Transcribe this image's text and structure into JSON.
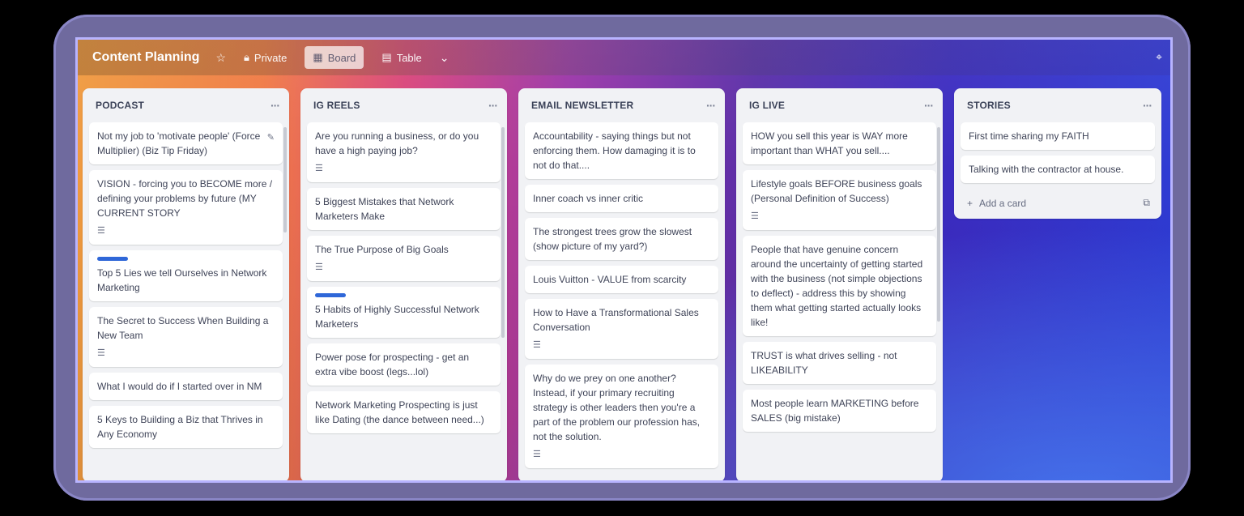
{
  "board": {
    "title": "Content Planning",
    "star_icon": "star-icon",
    "visibility": "Private",
    "views": [
      {
        "label": "Board",
        "icon": "board-icon",
        "active": true
      },
      {
        "label": "Table",
        "icon": "table-icon",
        "active": false
      }
    ],
    "more_views_icon": "chevron-down-icon",
    "right_icon": "pin-icon"
  },
  "lists": [
    {
      "title": "PODCAST",
      "cards": [
        {
          "text": "Not my job to 'motivate people' (Force Multiplier) (Biz Tip Friday)",
          "edit": true
        },
        {
          "text": "VISION - forcing you to BECOME more / defining your problems by future (MY CURRENT STORY",
          "desc": true
        },
        {
          "text": "Top 5 Lies we tell Ourselves in Network Marketing",
          "label": true
        },
        {
          "text": "The Secret to Success When Building a New Team",
          "desc": true
        },
        {
          "text": "What I would do if I started over in NM"
        },
        {
          "text": "5 Keys to Building a Biz that Thrives in Any Economy"
        }
      ]
    },
    {
      "title": "IG REELS",
      "cards": [
        {
          "text": "Are you running a business, or do you have a high paying job?",
          "desc": true
        },
        {
          "text": "5 Biggest Mistakes that Network Marketers Make"
        },
        {
          "text": "The True Purpose of Big Goals",
          "desc": true
        },
        {
          "text": "5 Habits of Highly Successful Network Marketers",
          "label": true
        },
        {
          "text": "Power pose for prospecting - get an extra vibe boost (legs...lol)"
        },
        {
          "text": "Network Marketing Prospecting is just like Dating (the dance between need...)"
        }
      ]
    },
    {
      "title": "EMAIL NEWSLETTER",
      "cards": [
        {
          "text": "Accountability - saying things but not enforcing them. How damaging it is to not do that...."
        },
        {
          "text": "Inner coach vs inner critic"
        },
        {
          "text": "The strongest trees grow the slowest (show picture of my yard?)"
        },
        {
          "text": "Louis Vuitton - VALUE from scarcity"
        },
        {
          "text": "How to Have a Transformational Sales Conversation",
          "desc": true
        },
        {
          "text": "Why do we prey on one another? Instead, if your primary recruiting strategy is other leaders then you're a part of the problem our profession has, not the solution.",
          "desc": true
        }
      ]
    },
    {
      "title": "IG LIVE",
      "cards": [
        {
          "text": "HOW you sell this year is WAY more important than WHAT you sell...."
        },
        {
          "text": "Lifestyle goals BEFORE business goals (Personal Definition of Success)",
          "desc": true
        },
        {
          "text": "People that have genuine concern around the uncertainty of getting started with the business (not simple objections to deflect) - address this by showing them what getting started actually looks like!"
        },
        {
          "text": "TRUST is what drives selling - not LIKEABILITY"
        },
        {
          "text": "Most people learn MARKETING before SALES (big mistake)"
        }
      ]
    },
    {
      "title": "STORIES",
      "cards": [
        {
          "text": "First time sharing my FAITH"
        },
        {
          "text": "Talking with the contractor at house."
        }
      ],
      "add_card": "Add a card"
    }
  ]
}
